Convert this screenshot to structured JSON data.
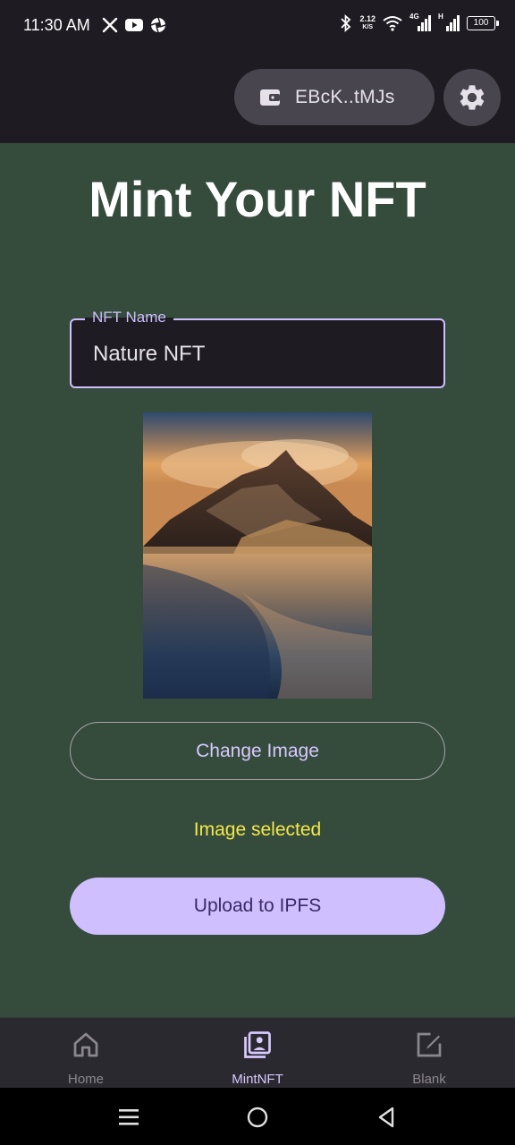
{
  "status_bar": {
    "time": "11:30 AM",
    "left_icons": [
      "x-icon",
      "youtube-icon",
      "aperture-icon"
    ],
    "net_speed_value": "2.12",
    "net_speed_unit": "K/S",
    "network_label": "4G",
    "signal2_label": "H",
    "battery": "100"
  },
  "app_bar": {
    "wallet_label": "EBcK..tMJs",
    "wallet_icon": "wallet-icon",
    "settings_icon": "gear-icon"
  },
  "main": {
    "title": "Mint Your NFT",
    "name_field": {
      "label": "NFT Name",
      "value": "Nature NFT"
    },
    "image_alt": "mountain-lake-image",
    "change_image_label": "Change Image",
    "status_message": "Image selected",
    "upload_label": "Upload to IPFS"
  },
  "bottom_nav": {
    "items": [
      {
        "label": "Home",
        "icon": "home-icon",
        "active": false
      },
      {
        "label": "MintNFT",
        "icon": "gallery-icon",
        "active": true
      },
      {
        "label": "Blank",
        "icon": "edit-icon",
        "active": false
      }
    ]
  },
  "colors": {
    "main_bg": "#354c3c",
    "accent": "#cfbfff",
    "status_message": "#f5e84a",
    "bar_bg": "#1e1c22"
  }
}
